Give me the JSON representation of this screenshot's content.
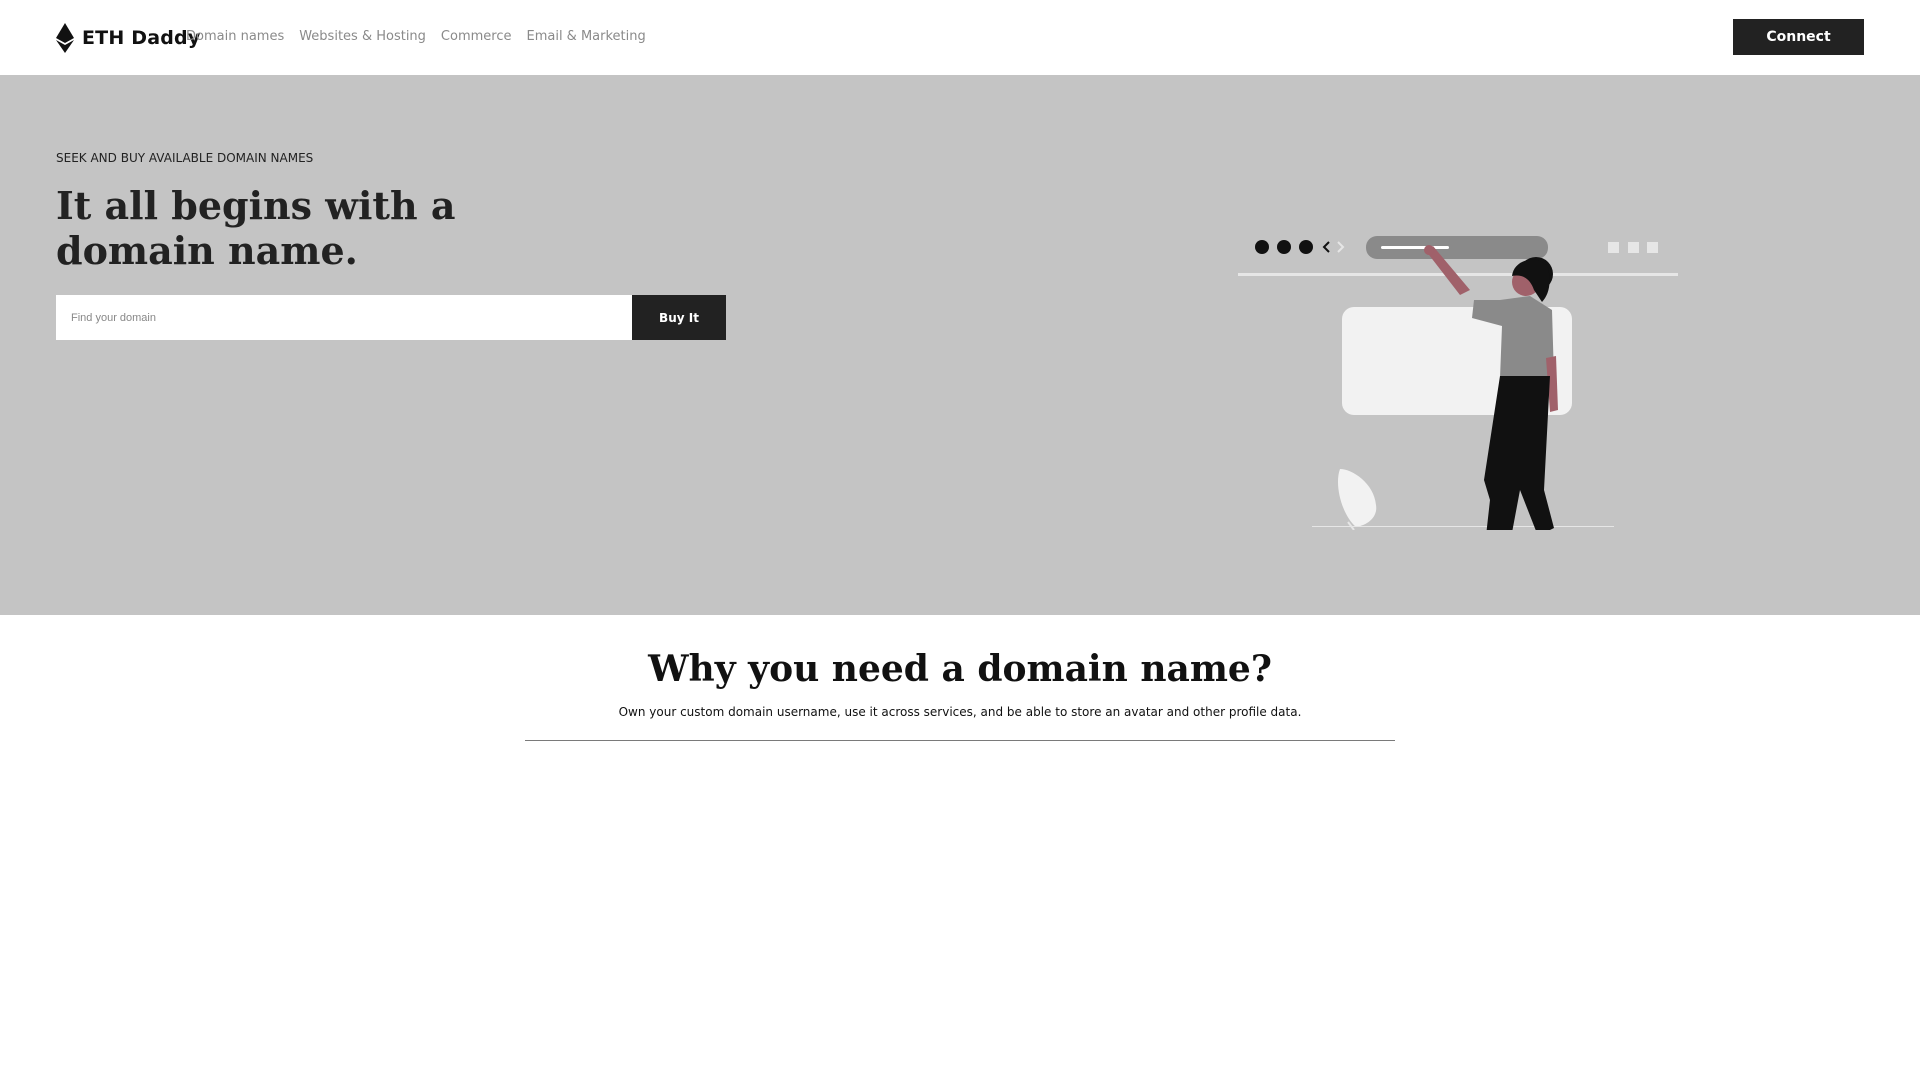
{
  "nav": {
    "brand": "ETH Daddy",
    "links": [
      "Domain names",
      "Websites & Hosting",
      "Commerce",
      "Email & Marketing"
    ],
    "connect_label": "Connect"
  },
  "hero": {
    "eyebrow": "SEEK AND BUY AVAILABLE DOMAIN NAMES",
    "title": "It all begins with a domain name.",
    "search_placeholder": "Find your domain",
    "buy_label": "Buy It"
  },
  "section": {
    "title": "Why you need a domain name?",
    "text": "Own your custom domain username, use it across services, and be able to store an avatar and other profile data."
  },
  "colors": {
    "hero_bg": "#c4c4c4",
    "dark": "#222222",
    "accent_skin": "#a0616a"
  }
}
